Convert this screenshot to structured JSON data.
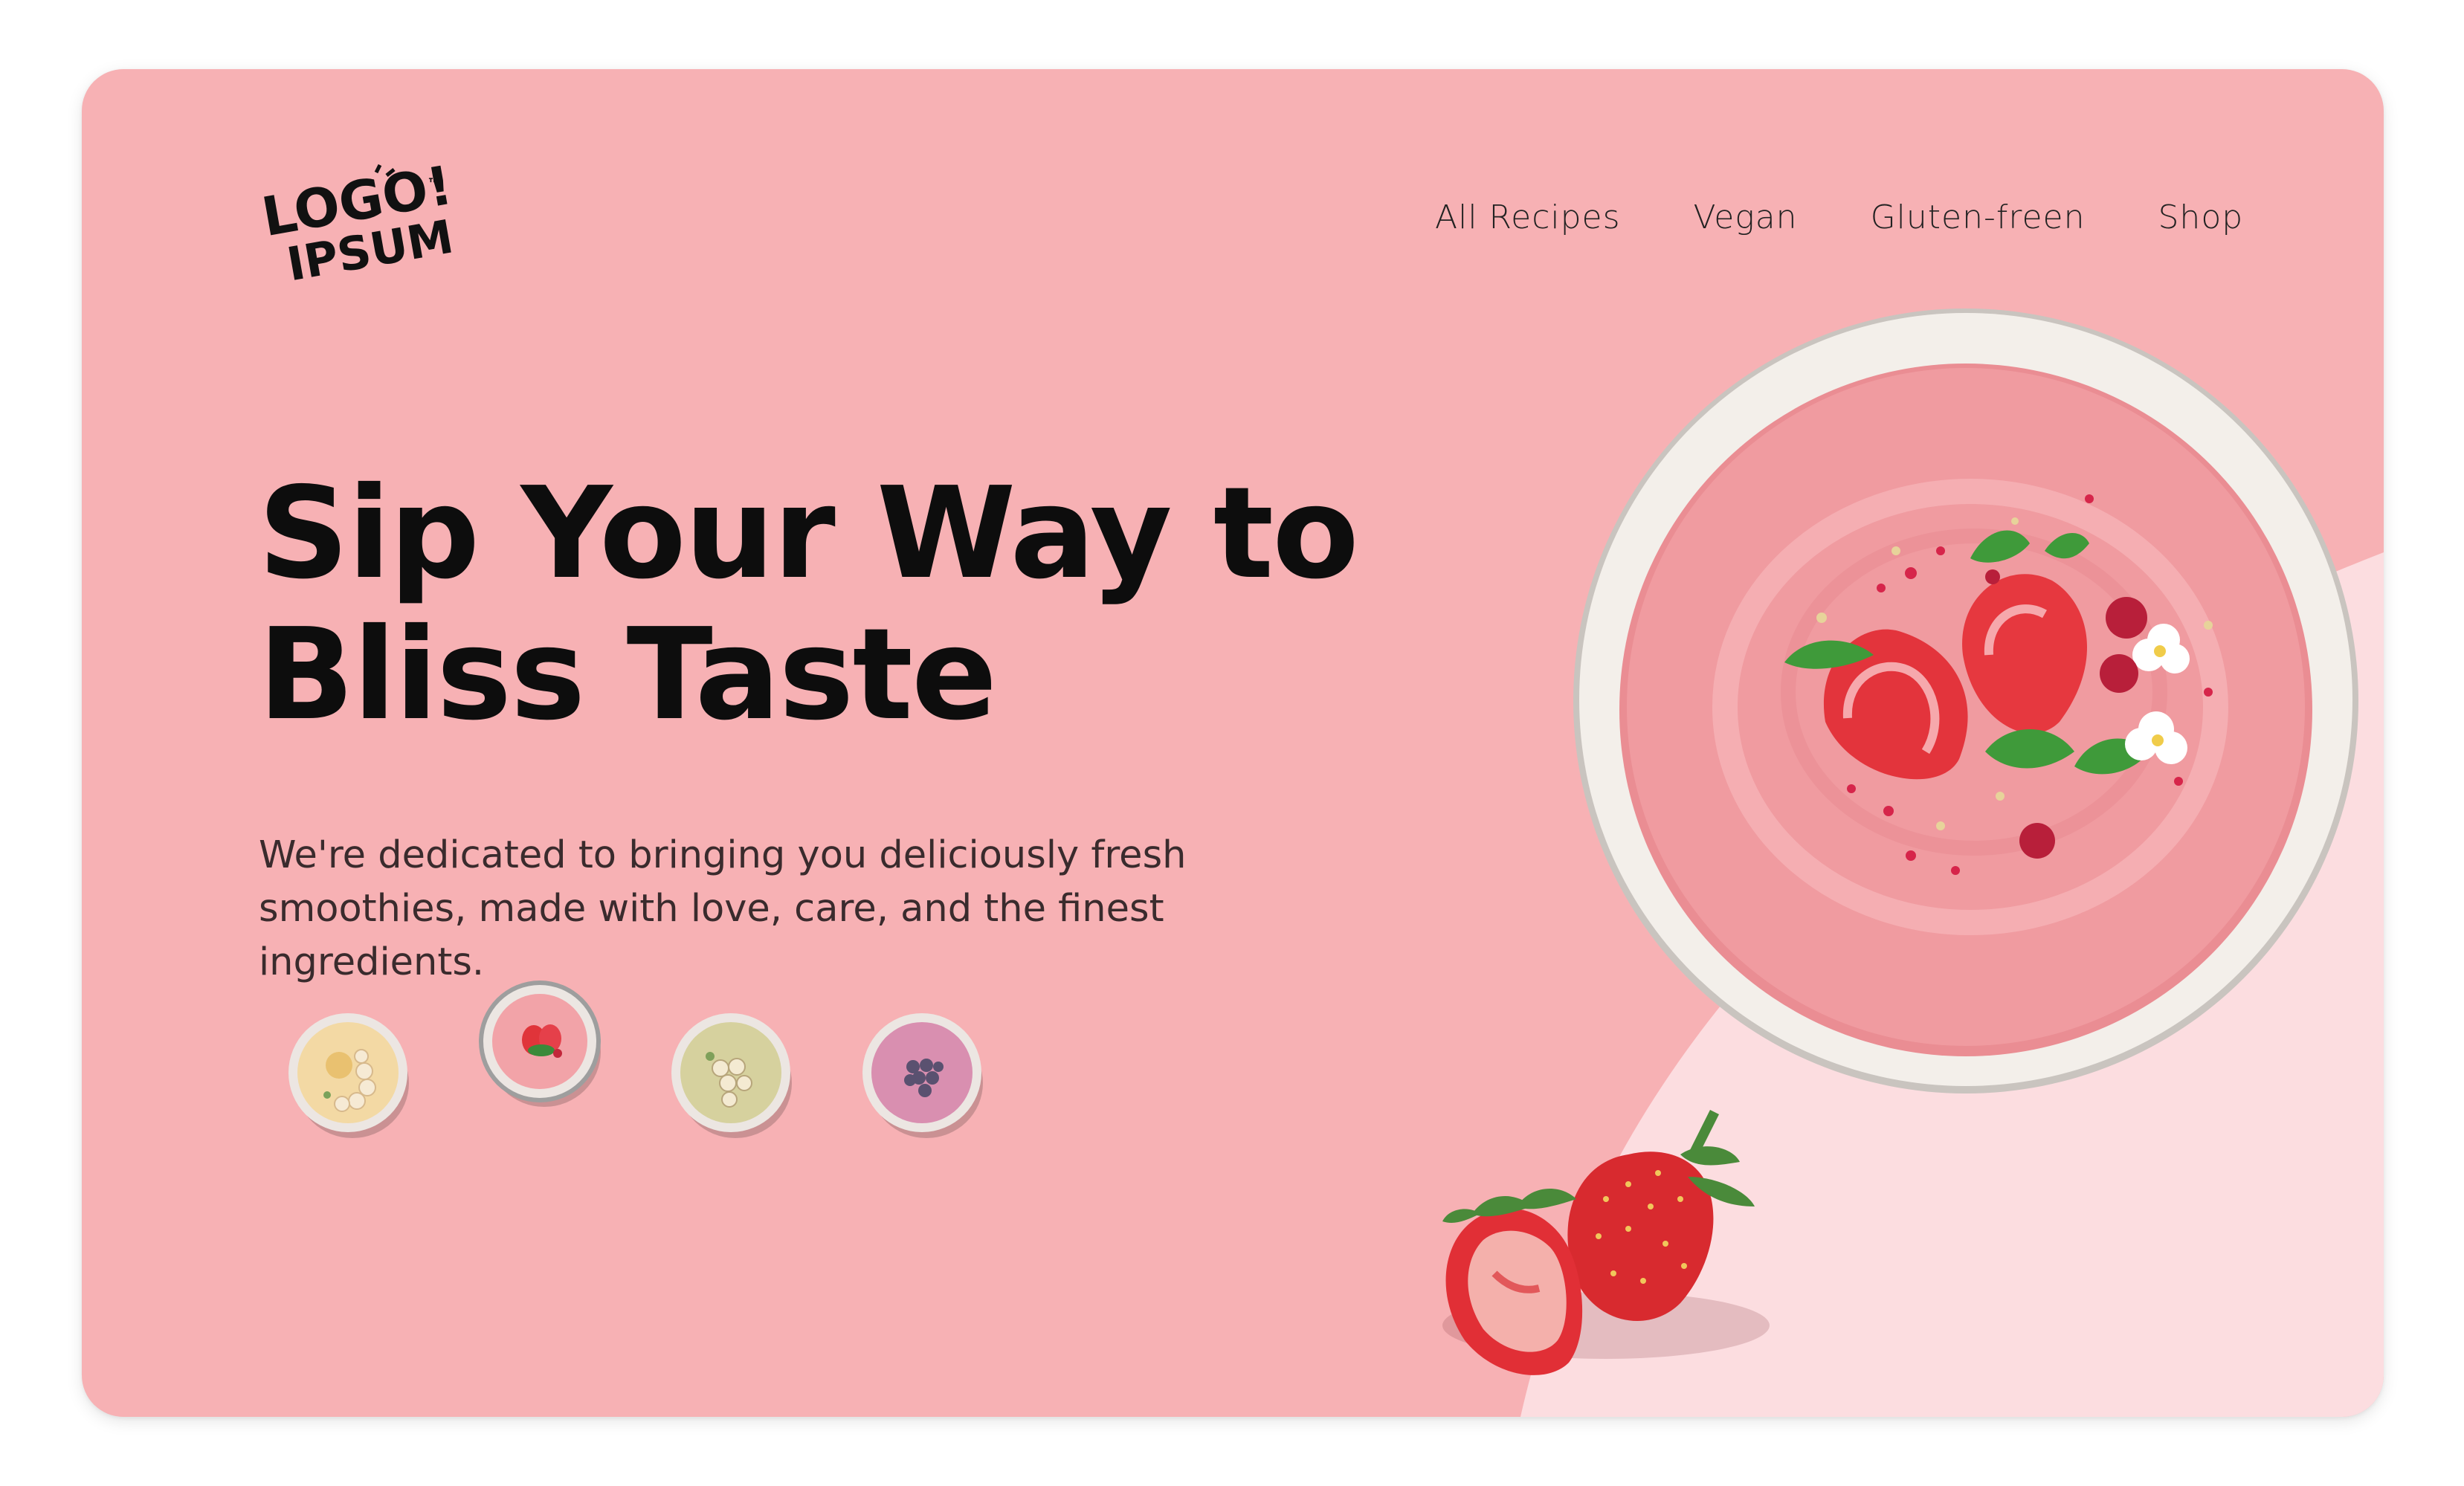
{
  "brand": {
    "logo_line1": "LOGO!",
    "logo_line2": "IPSUM",
    "logo_mark": "™"
  },
  "nav": {
    "items": [
      {
        "label": "All Recipes"
      },
      {
        "label": "Vegan"
      },
      {
        "label": "Gluten-freen"
      },
      {
        "label": "Shop"
      }
    ]
  },
  "hero": {
    "title_line1": "Sip Your Way to",
    "title_line2": "Bliss Taste",
    "description": "We're dedicated to bringing you deliciously fresh smoothies, made with love, care, and the finest ingredients."
  },
  "thumbnails": [
    {
      "name": "banana smoothie bowl",
      "color": "#f3d9a4",
      "selected": false
    },
    {
      "name": "strawberry smoothie bowl",
      "color": "#f2a3a8",
      "selected": true
    },
    {
      "name": "kiwi banana smoothie bowl",
      "color": "#d6d19e",
      "selected": false
    },
    {
      "name": "blueberry smoothie bowl",
      "color": "#d98fb0",
      "selected": false
    }
  ],
  "colors": {
    "card_bg": "#f7b1b4",
    "card_shape": "#fcdde0",
    "text_primary": "#0d0d0d"
  }
}
